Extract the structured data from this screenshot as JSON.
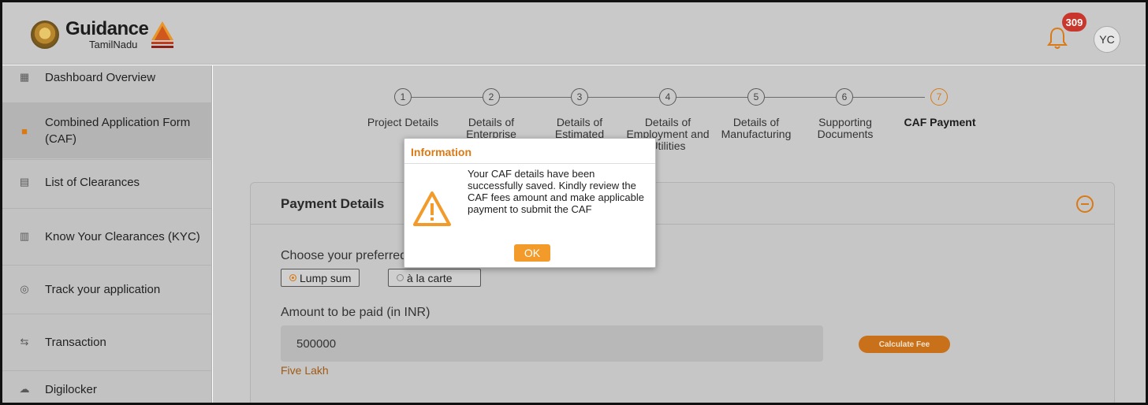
{
  "header": {
    "logo_text": "Guidance",
    "logo_sub": "TamilNadu",
    "notification_count": "309",
    "avatar_initials": "YC"
  },
  "sidebar": {
    "items": [
      {
        "label": "Dashboard Overview",
        "icon": "dashboard-icon"
      },
      {
        "label": "Combined Application Form (CAF)",
        "icon": "document-icon"
      },
      {
        "label": "List of Clearances",
        "icon": "list-icon"
      },
      {
        "label": "Know Your Clearances (KYC)",
        "icon": "book-icon"
      },
      {
        "label": "Track your application",
        "icon": "location-icon"
      },
      {
        "label": "Transaction",
        "icon": "transaction-icon"
      },
      {
        "label": "Digilocker",
        "icon": "cloud-icon"
      }
    ]
  },
  "stepper": {
    "steps": [
      {
        "num": "1",
        "label": "Project Details"
      },
      {
        "num": "2",
        "label": "Details of Enterprise"
      },
      {
        "num": "3",
        "label": "Details of Estimated"
      },
      {
        "num": "4",
        "label": "Details of Employment and Utilities"
      },
      {
        "num": "5",
        "label": "Details of Manufacturing"
      },
      {
        "num": "6",
        "label": "Supporting Documents"
      },
      {
        "num": "7",
        "label": "CAF Payment"
      }
    ]
  },
  "payment": {
    "title": "Payment Details",
    "fee_slab_label": "Choose your preferred Fee slab *",
    "options": [
      "Lump sum",
      "à la carte"
    ],
    "selected_option": "Lump sum",
    "amount_label": "Amount to be paid (in INR)",
    "amount_value": "500000",
    "calculate_label": "Calculate Fee",
    "amount_words": "Five Lakh"
  },
  "modal": {
    "title": "Information",
    "message": "Your CAF details have been successfully saved. Kindly review the CAF fees amount and make applicable payment to submit the CAF",
    "ok_label": "OK"
  },
  "colors": {
    "accent": "#d97a16",
    "badge": "#c9372c",
    "overlay_bg": "#c9c9c9"
  }
}
